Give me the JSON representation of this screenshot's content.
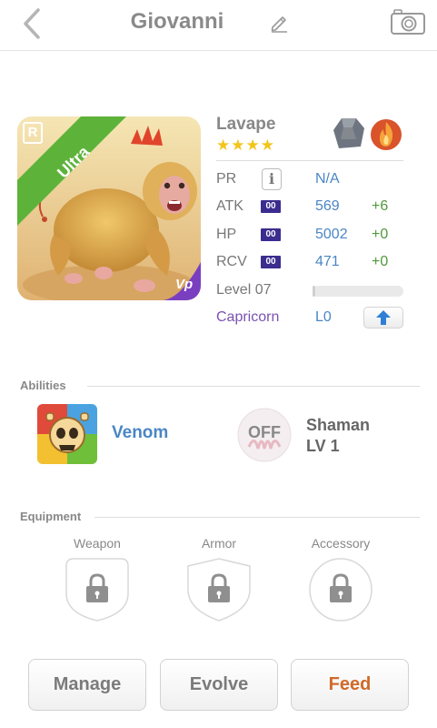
{
  "header": {
    "title": "Giovanni",
    "back_icon": "chevron-left-icon",
    "edit_icon": "pencil-icon",
    "camera_icon": "camera-icon"
  },
  "monster": {
    "name": "Lavape",
    "stars": "★★★★",
    "star_count": 4,
    "rarity_badge": "Ultra",
    "rank_badge": "R",
    "portrait_corner_badge": "Vp",
    "elements": [
      "rock-element-icon",
      "fire-element-icon"
    ]
  },
  "stats": {
    "pr": {
      "label": "PR",
      "icon": "i",
      "value": "N/A"
    },
    "atk": {
      "label": "ATK",
      "chip": "00",
      "value": "569",
      "plus": "+6"
    },
    "hp": {
      "label": "HP",
      "chip": "00",
      "value": "5002",
      "plus": "+0"
    },
    "rcv": {
      "label": "RCV",
      "chip": "00",
      "value": "471",
      "plus": "+0"
    },
    "level": {
      "label": "Level 07",
      "progress": 0.03
    },
    "zodiac": {
      "label": "Capricorn",
      "value": "L0",
      "upgrade_icon": "arrow-up-icon"
    }
  },
  "abilities": {
    "section_label": "Abilities",
    "skill_name": "Venom",
    "leader_badge": "OFF",
    "leader_name_line1": "Shaman",
    "leader_name_line2": "LV 1"
  },
  "equipment": {
    "section_label": "Equipment",
    "slots": [
      {
        "label": "Weapon",
        "icon": "lock-icon"
      },
      {
        "label": "Armor",
        "icon": "lock-icon"
      },
      {
        "label": "Accessory",
        "icon": "lock-icon"
      }
    ]
  },
  "actions": {
    "manage": "Manage",
    "evolve": "Evolve",
    "feed": "Feed"
  },
  "colors": {
    "value_blue": "#4a86c5",
    "plus_green": "#4f9a3a",
    "zodiac_purple": "#7a52b2",
    "feed_orange": "#d06a2a",
    "chip_navy": "#3b2c8f",
    "ultra_green": "#5db33a"
  }
}
